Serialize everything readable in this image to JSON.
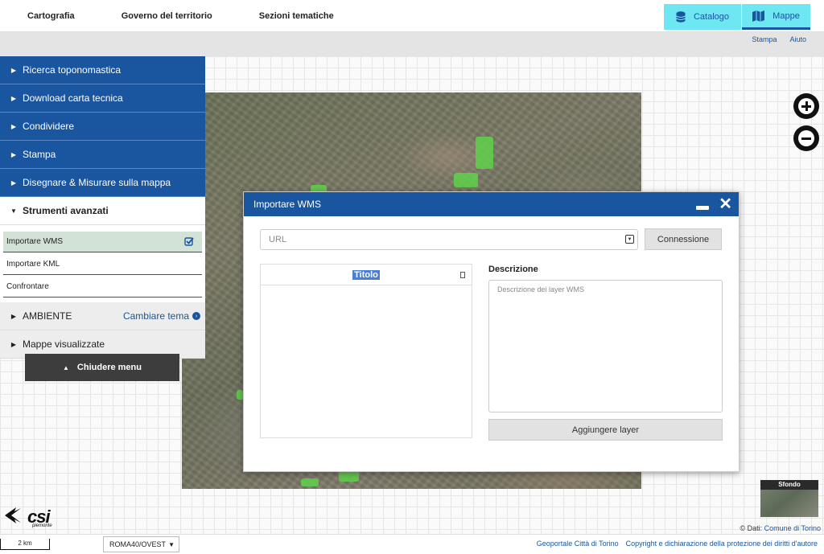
{
  "topnav": {
    "items": [
      "Cartografia",
      "Governo del territorio",
      "Sezioni tematiche"
    ],
    "catalogo": "Catalogo",
    "mappe": "Mappe"
  },
  "sublinks": {
    "stampa": "Stampa",
    "aiuto": "Aiuto"
  },
  "panel": {
    "items": [
      "Ricerca toponomastica",
      "Download carta tecnica",
      "Condividere",
      "Stampa",
      "Disegnare & Misurare sulla mappa"
    ],
    "advanced": "Strumenti avanzati",
    "subitems": [
      "Importare WMS",
      "Importare KML",
      "Confrontare"
    ],
    "ambiente": "AMBIENTE",
    "cambiare_tema": "Cambiare tema",
    "mappe_visualizzate": "Mappe visualizzate",
    "close": "Chiudere menu"
  },
  "dialog": {
    "title": "Importare WMS",
    "url_placeholder": "URL",
    "connect": "Connessione",
    "column_title": "Titolo",
    "desc_label": "Descrizione",
    "desc_placeholder": "Descrizione dei layer WMS",
    "add_layer": "Aggiungere layer"
  },
  "sfondo": "Sfondo",
  "logo": {
    "name": "csi",
    "sub": "piemonte"
  },
  "credits": {
    "prefix": "© Dati:",
    "link": "Comune di Torino"
  },
  "footer": {
    "scale": "2 km",
    "projection": "ROMA40/OVEST",
    "links": [
      "Geoportale Città di Torino",
      "Copyright e dichiarazione della protezione dei diritti d'autore"
    ]
  },
  "colors": {
    "primary": "#1a55a0",
    "accent": "#6ee7f3",
    "dark_button": "#3d3d3d"
  }
}
